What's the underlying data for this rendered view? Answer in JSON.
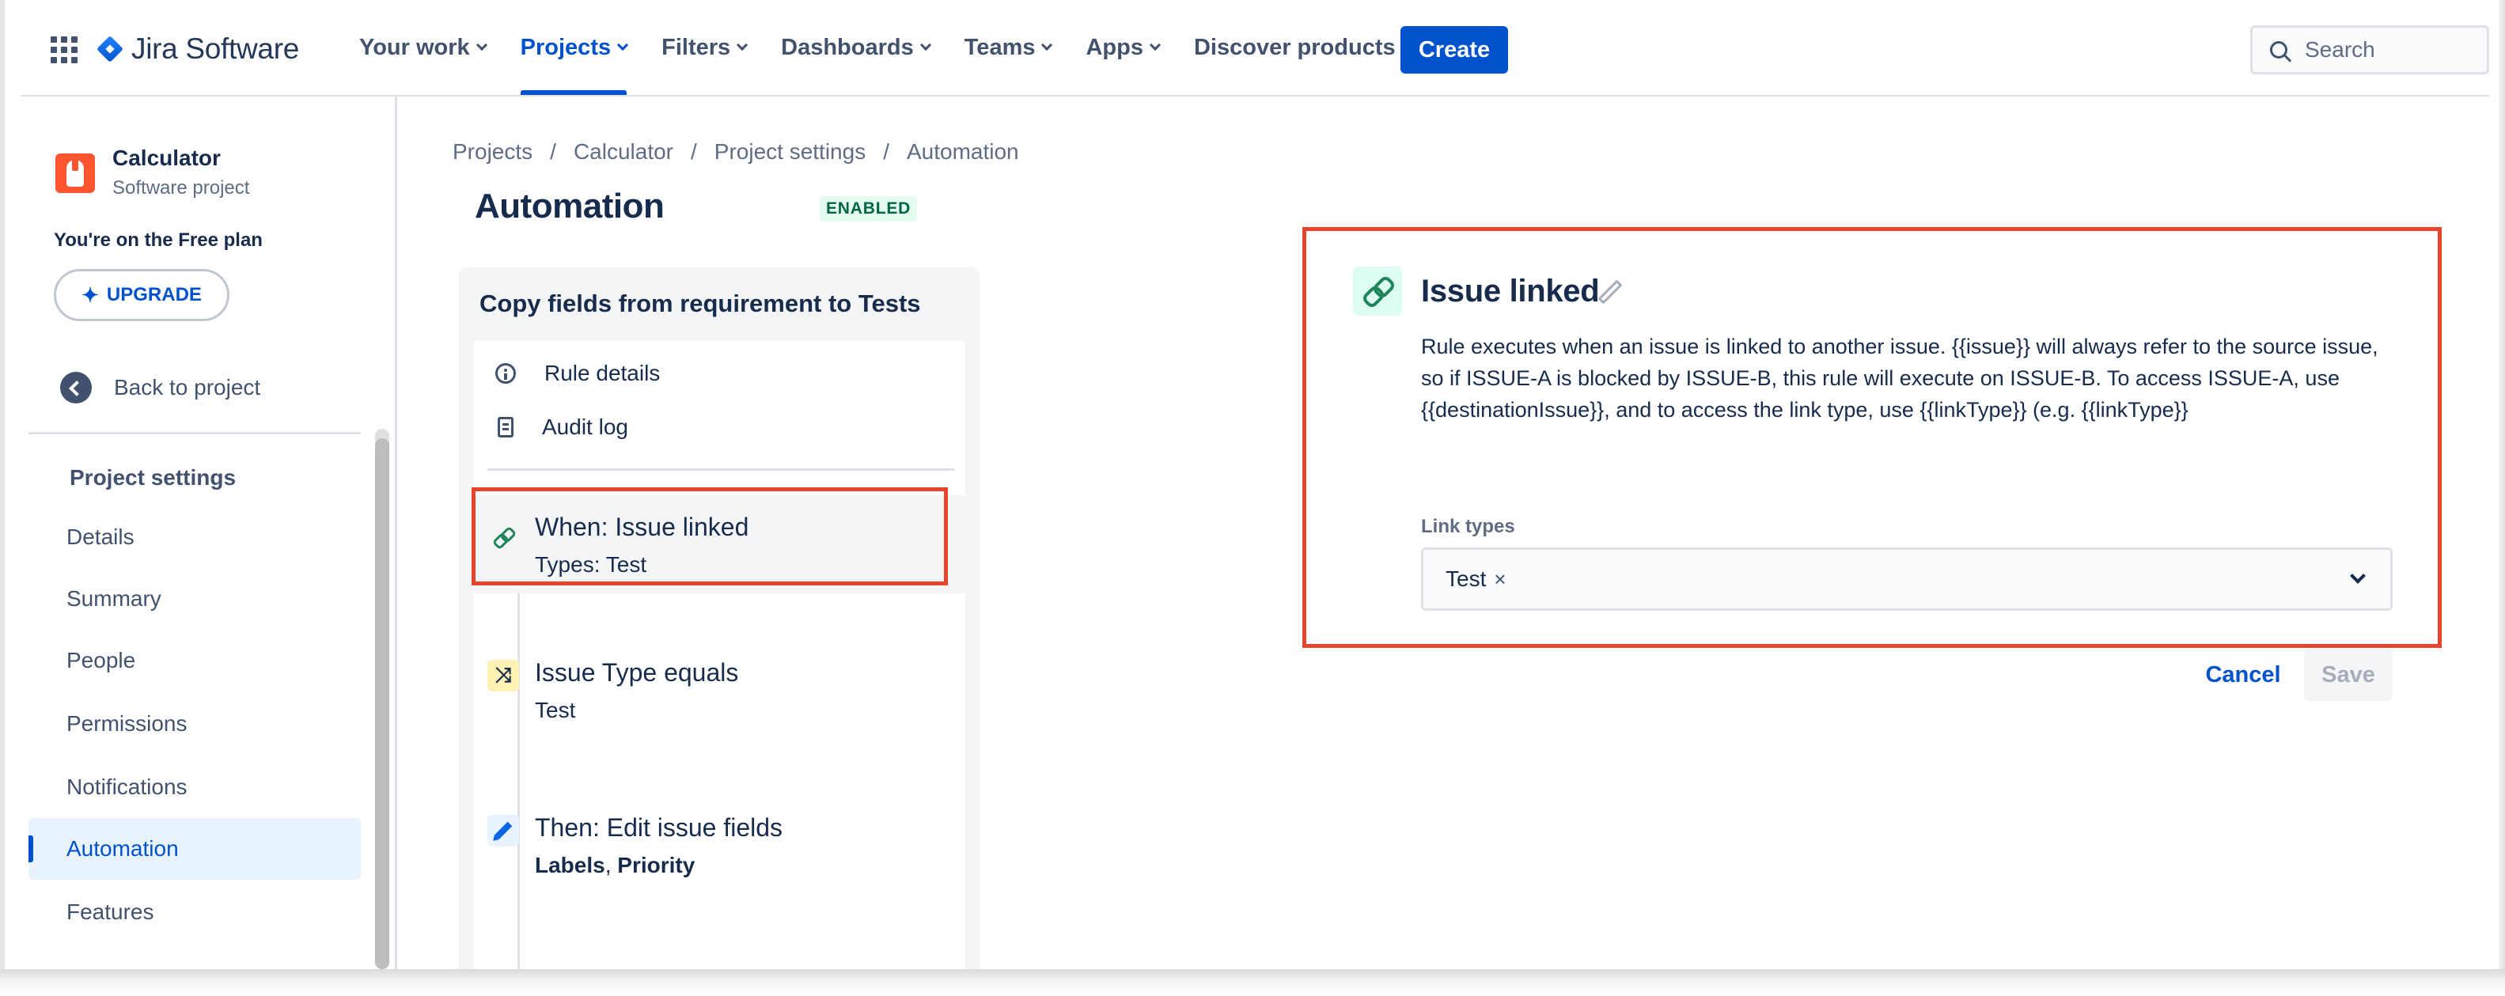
{
  "topnav": {
    "logo_text": "Jira Software",
    "items": [
      {
        "label": "Your work",
        "dropdown": true,
        "active": false
      },
      {
        "label": "Projects",
        "dropdown": true,
        "active": true
      },
      {
        "label": "Filters",
        "dropdown": true,
        "active": false
      },
      {
        "label": "Dashboards",
        "dropdown": true,
        "active": false
      },
      {
        "label": "Teams",
        "dropdown": true,
        "active": false
      },
      {
        "label": "Apps",
        "dropdown": true,
        "active": false
      },
      {
        "label": "Discover products",
        "dropdown": false,
        "active": false
      }
    ],
    "create_label": "Create",
    "search_placeholder": "Search"
  },
  "sidebar": {
    "project_name": "Calculator",
    "project_type": "Software project",
    "plan_text": "You're on the Free plan",
    "upgrade_label": "UPGRADE",
    "back_label": "Back to project",
    "section_title": "Project settings",
    "items": [
      {
        "label": "Details",
        "active": false
      },
      {
        "label": "Summary",
        "active": false
      },
      {
        "label": "People",
        "active": false
      },
      {
        "label": "Permissions",
        "active": false
      },
      {
        "label": "Notifications",
        "active": false
      },
      {
        "label": "Automation",
        "active": true
      },
      {
        "label": "Features",
        "active": false
      }
    ]
  },
  "breadcrumb": [
    "Projects",
    "Calculator",
    "Project settings",
    "Automation"
  ],
  "page": {
    "title": "Automation",
    "status_badge": "ENABLED"
  },
  "rule": {
    "name": "Copy fields from requirement to Tests",
    "meta": {
      "rule_details": "Rule details",
      "audit_log": "Audit log"
    },
    "steps": [
      {
        "title": "When: Issue linked",
        "sub_plain": "Types: Test",
        "icon": "link-icon",
        "selected": true
      },
      {
        "title": "Issue Type equals",
        "sub_plain": "Test",
        "icon": "shuffle-icon",
        "selected": false
      },
      {
        "title": "Then: Edit issue fields",
        "sub_bold_1": "Labels",
        "sub_sep": ", ",
        "sub_bold_2": "Priority",
        "icon": "pencil-icon",
        "selected": false
      }
    ]
  },
  "trigger_config": {
    "title": "Issue linked",
    "description": "Rule executes when an issue is linked to another issue. {{issue}} will always refer to the source issue, so if ISSUE-A is blocked by ISSUE-B, this rule will execute on ISSUE-B. To access ISSUE-A, use {{destinationIssue}}, and to access the link type, use {{linkType}} (e.g. {{linkType}}",
    "field_label": "Link types",
    "selected_values": [
      "Test"
    ],
    "remove_glyph": "×",
    "cancel_label": "Cancel",
    "save_label": "Save"
  },
  "colors": {
    "brand_blue": "#0052cc",
    "highlight_red": "#e8432b",
    "enabled_green": "#006644",
    "link_green": "#1f845a"
  }
}
